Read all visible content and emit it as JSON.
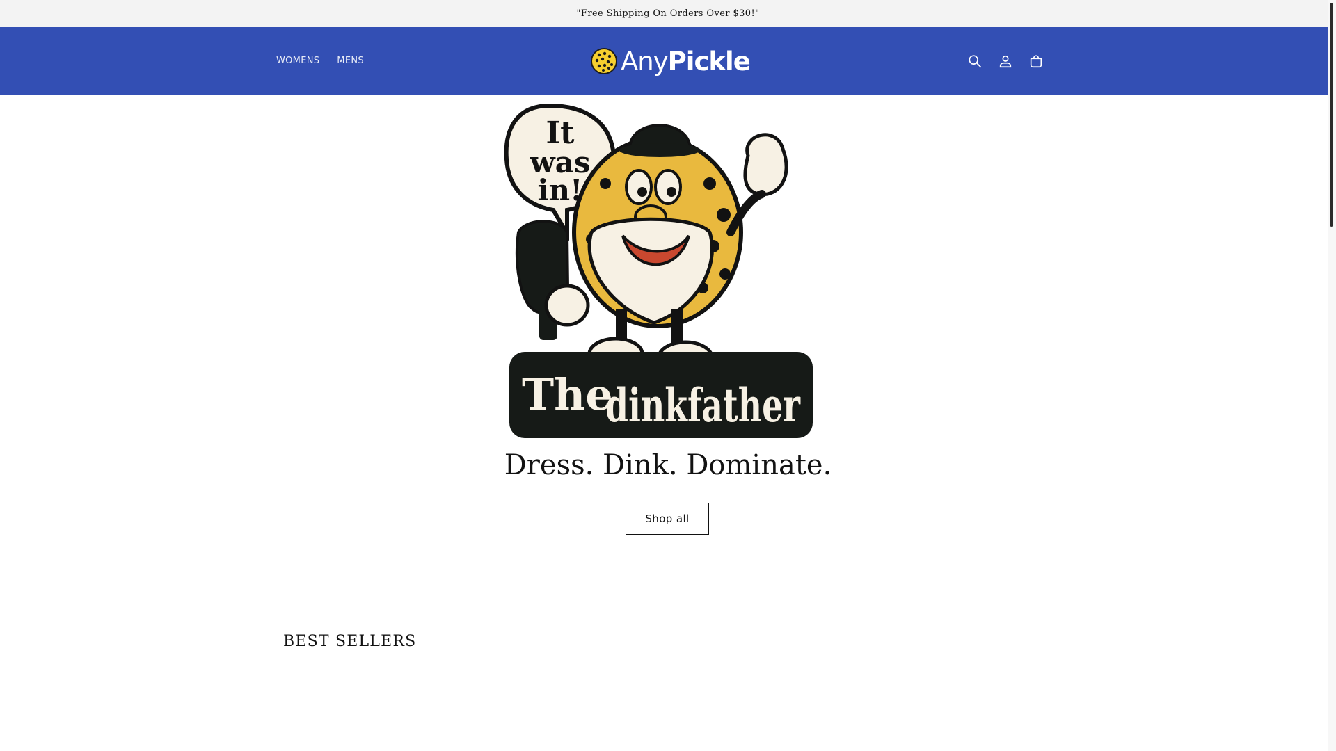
{
  "announcement": {
    "text": "\"Free Shipping On Orders Over $30!\""
  },
  "header": {
    "background_color": "#334fb4",
    "nav": [
      {
        "label": "WOMENS"
      },
      {
        "label": "MENS"
      }
    ],
    "logo": {
      "text_light": "Any",
      "text_bold": "Pickle",
      "icon": "pickleball-icon"
    },
    "icons": [
      {
        "name": "search-icon",
        "label": "Search"
      },
      {
        "name": "account-icon",
        "label": "Log in"
      },
      {
        "name": "cart-icon",
        "label": "Cart"
      }
    ]
  },
  "hero": {
    "artwork": {
      "speech_bubble": "It was in!",
      "banner_prefix": "The",
      "banner_title": "dinkfather"
    },
    "heading": "Dress. Dink. Dominate.",
    "cta_label": "Shop all"
  },
  "best_sellers": {
    "title": "BEST SELLERS"
  }
}
